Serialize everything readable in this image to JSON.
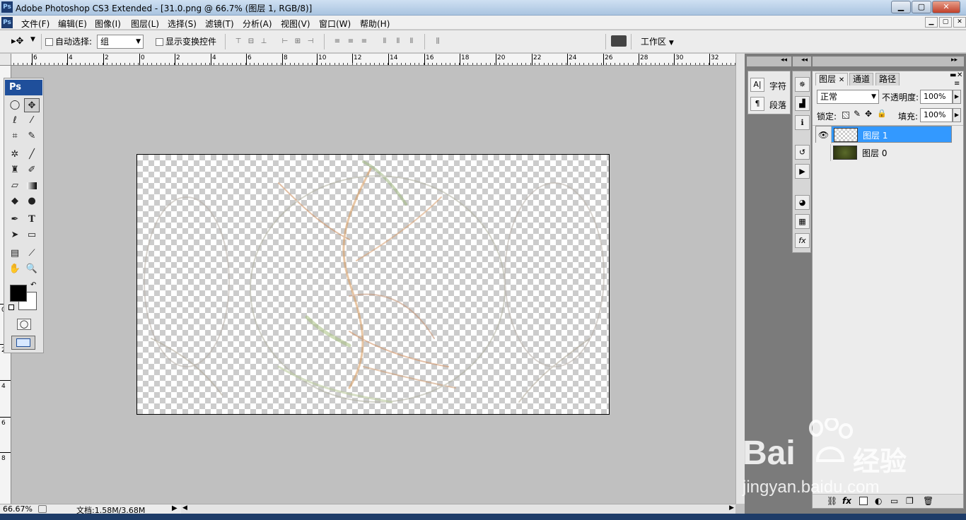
{
  "window": {
    "app_title": "Adobe Photoshop CS3 Extended - [31.0.png @ 66.7% (图层 1, RGB/8)]",
    "logo": "Ps",
    "minimize": "▁",
    "maximize": "▢",
    "close": "✕"
  },
  "menu": {
    "items": [
      "文件(F)",
      "编辑(E)",
      "图像(I)",
      "图层(L)",
      "选择(S)",
      "滤镜(T)",
      "分析(A)",
      "视图(V)",
      "窗口(W)",
      "帮助(H)"
    ],
    "mdi_min": "▁",
    "mdi_max": "▢",
    "mdi_close": "✕"
  },
  "options": {
    "tool_glyph": "▸✥",
    "auto_select_label": "自动选择:",
    "auto_select_value": "组",
    "show_transform_label": "显示变换控件",
    "workspace_label": "工作区"
  },
  "ruler": {
    "h_ticks": [
      "6",
      "4",
      "2",
      "0",
      "2",
      "4",
      "6",
      "8",
      "10",
      "12",
      "14",
      "16",
      "18",
      "20",
      "22",
      "24",
      "26",
      "28",
      "30",
      "32"
    ],
    "v_ticks": [
      "0",
      "2",
      "4",
      "6",
      "8"
    ]
  },
  "tools": {
    "header": "Ps",
    "type_tool": "T"
  },
  "status": {
    "zoom": "66.67%",
    "doc": "文档:1.58M/3.68M"
  },
  "char_panel": {
    "char_label": "字符",
    "para_label": "段落",
    "char_glyph": "A|",
    "para_glyph": "¶"
  },
  "layers_panel": {
    "tabs": [
      "图层",
      "通道",
      "路径"
    ],
    "blend_mode": "正常",
    "opacity_label": "不透明度:",
    "opacity_value": "100%",
    "lock_label": "锁定:",
    "fill_label": "填充:",
    "fill_value": "100%",
    "layers": [
      {
        "name": "图层 1",
        "visible": true,
        "selected": true
      },
      {
        "name": "图层 0",
        "visible": false,
        "selected": false
      }
    ],
    "footer_icons": [
      "link-icon",
      "fx-icon",
      "mask-icon",
      "adjustment-icon",
      "folder-icon",
      "new-layer-icon",
      "trash-icon"
    ]
  },
  "watermark": {
    "brand": "Bai",
    "brand_cn": "经验",
    "url": "jingyan.baidu.com"
  },
  "colors": {
    "selection": "#3399ff",
    "ps_blue": "#1f4f9b",
    "panel_gray": "#7b7b7b"
  }
}
